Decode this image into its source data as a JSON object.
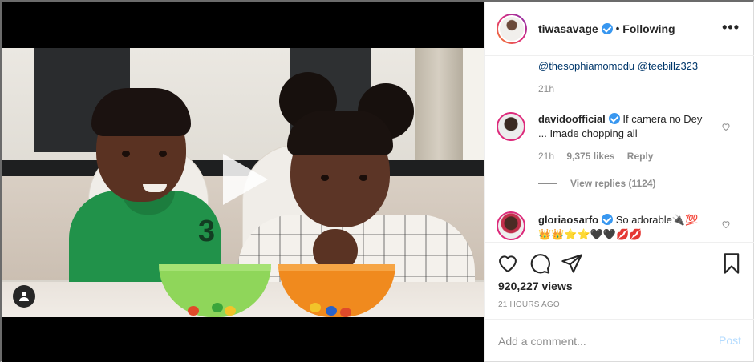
{
  "post": {
    "username": "tiwasavage",
    "follow_status": "Following",
    "more_icon": "more-horizontal-icon",
    "views": "920,227 views",
    "posted_time": "21 HOURS AGO"
  },
  "comments": {
    "caption_tail": {
      "mentions": [
        "@thesophiamomodu",
        "@teebillz323"
      ],
      "time": "21h"
    },
    "items": [
      {
        "username": "davidoofficial",
        "text_line1": "If camera no Dey",
        "text_line2": "... Imade chopping all",
        "time": "21h",
        "likes": "9,375 likes",
        "reply_label": "Reply",
        "view_replies": "View replies (1124)"
      },
      {
        "username": "gloriaosarfo",
        "text_line1": "So adorable🔌💯",
        "text_line2": "👑👑⭐⭐🖤🖤💋💋"
      }
    ]
  },
  "add_comment": {
    "placeholder": "Add a comment...",
    "post_label": "Post"
  },
  "colors": {
    "accent": "#3897f0",
    "post_disabled": "#b3dbff",
    "meta": "#8e8e8e"
  }
}
